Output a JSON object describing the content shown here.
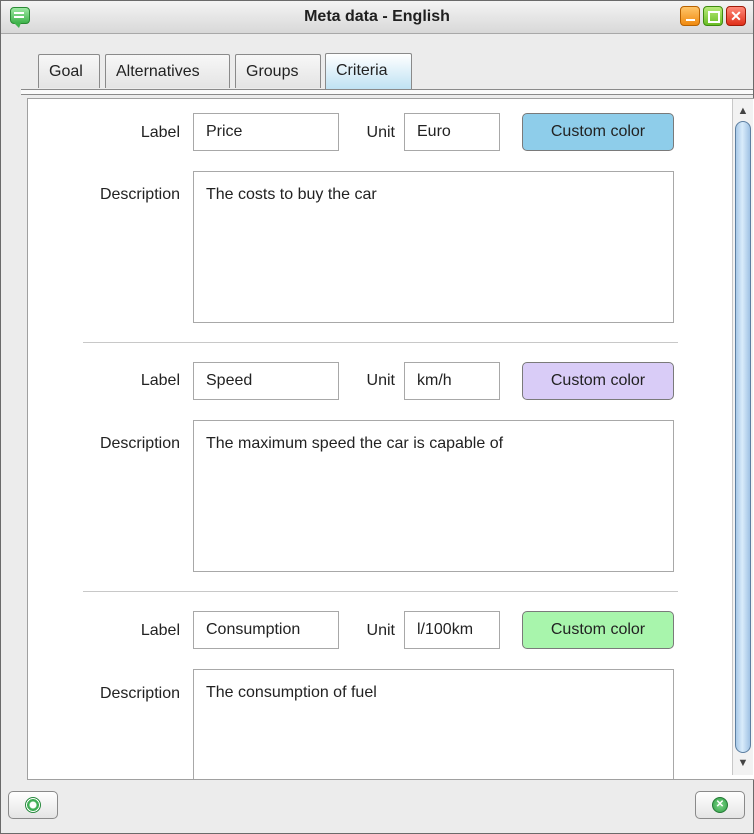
{
  "window": {
    "title": "Meta data - English",
    "icon": "speech-bubble-icon"
  },
  "tabs": [
    {
      "label": "Goal",
      "active": false
    },
    {
      "label": "Alternatives",
      "active": false
    },
    {
      "label": "Groups",
      "active": false
    },
    {
      "label": "Criteria",
      "active": true
    }
  ],
  "criteria_form": {
    "label_text": "Label",
    "unit_text": "Unit",
    "description_text": "Description",
    "items": [
      {
        "label": "Price",
        "unit": "Euro",
        "color_button": "Custom color",
        "color": "#8ecdea",
        "description": "The costs to buy the car"
      },
      {
        "label": "Speed",
        "unit": "km/h",
        "color_button": "Custom color",
        "color": "#d9ccf7",
        "description": "The maximum speed the car is capable of"
      },
      {
        "label": "Consumption",
        "unit": "l/100km",
        "color_button": "Custom color",
        "color": "#a8f5ac",
        "description": "The consumption of fuel"
      }
    ]
  },
  "footer": {
    "help_icon": "lifebuoy-icon",
    "close_icon": "close-icon"
  }
}
